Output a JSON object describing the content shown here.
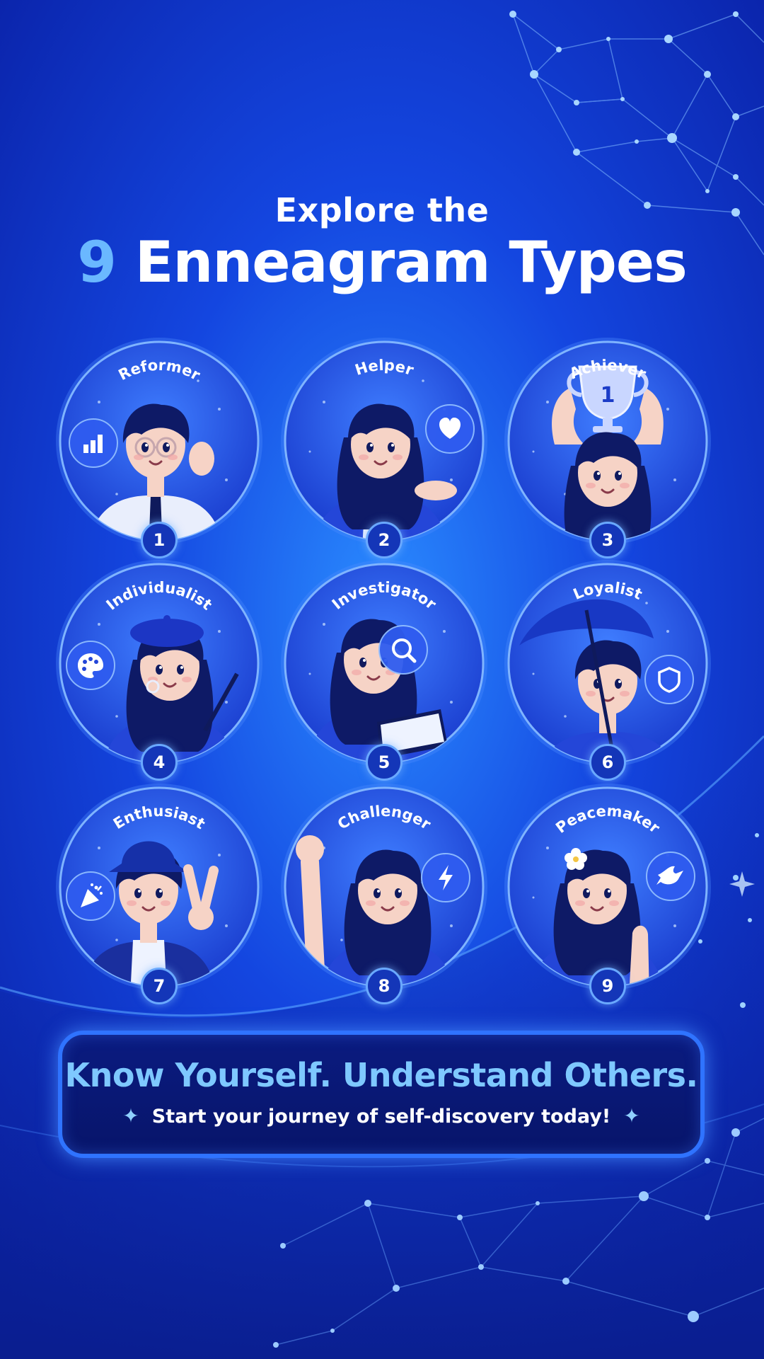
{
  "header": {
    "line1": "Explore the",
    "number": "9",
    "title": "Enneagram Types"
  },
  "types": [
    {
      "number": "1",
      "name": "Reformer",
      "icon": "bar-chart-icon"
    },
    {
      "number": "2",
      "name": "Helper",
      "icon": "heart-icon"
    },
    {
      "number": "3",
      "name": "Achiever",
      "icon": "trophy-icon",
      "trophy_text": "1"
    },
    {
      "number": "4",
      "name": "Individualist",
      "icon": "palette-icon"
    },
    {
      "number": "5",
      "name": "Investigator",
      "icon": "magnifier-icon"
    },
    {
      "number": "6",
      "name": "Loyalist",
      "icon": "shield-icon"
    },
    {
      "number": "7",
      "name": "Enthusiast",
      "icon": "party-popper-icon"
    },
    {
      "number": "8",
      "name": "Challenger",
      "icon": "lightning-icon"
    },
    {
      "number": "9",
      "name": "Peacemaker",
      "icon": "dove-icon"
    }
  ],
  "cta": {
    "headline": "Know Yourself. Understand Others.",
    "subline": "Start your journey of self-discovery today!",
    "star": "✦"
  },
  "colors": {
    "background": "#0b2fc9",
    "accent": "#6ab8ff",
    "cta_border": "#2f73ff",
    "cta_text": "#7ec8ff"
  }
}
